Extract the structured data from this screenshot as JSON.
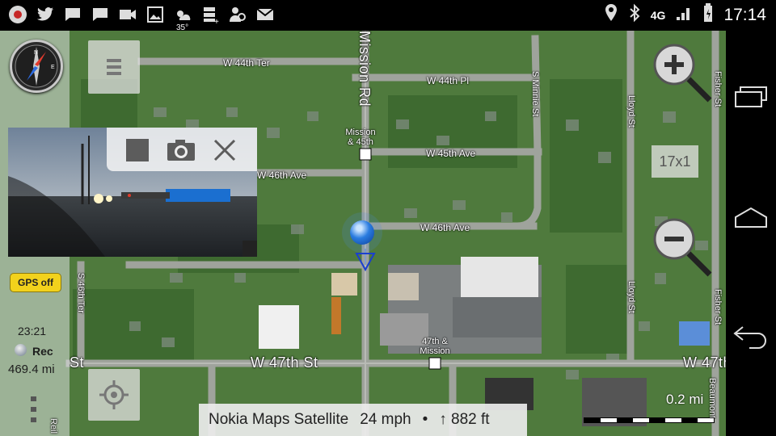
{
  "status_bar": {
    "notification_icons": [
      "record-icon",
      "twitter-icon",
      "chat-icon",
      "chat-icon",
      "video-icon",
      "image-icon",
      "weather-icon",
      "storage-icon",
      "people-icon",
      "gmail-icon"
    ],
    "temperature": "35°",
    "network": "4G",
    "time": "17:14"
  },
  "map": {
    "streets": [
      "W 44th Ter",
      "W 44th Pl",
      "W 45th Ave",
      "W 46th Ave",
      "W 46th Ave",
      "W 47th St",
      "W 47th St",
      "Mission Rd",
      "S Minnie St",
      "Lloyd St",
      "Lloyd St",
      "Fisher St",
      "Fisher St",
      "S 46th Ter",
      "S 46th Ter",
      "Beaumont"
    ],
    "poi": [
      "Mission & 45th",
      "47th & Mission"
    ],
    "left_partial_text": "St",
    "bottom_left_partial": "Reil",
    "zoom_level": "17x1",
    "scale": "0.2 mi"
  },
  "sidebar": {
    "gps_label": "GPS off",
    "time": "23:21",
    "rec_label": "Rec",
    "distance": "469.4 mi"
  },
  "bottom_bar": {
    "source": "Nokia Maps Satellite",
    "speed": "24 mph",
    "separator": "•",
    "altitude": "↑ 882 ft"
  },
  "colors": {
    "gps_button": "#f2d21c",
    "location_dot": "#2a7ce0",
    "map_base": "#4d7a3c"
  }
}
